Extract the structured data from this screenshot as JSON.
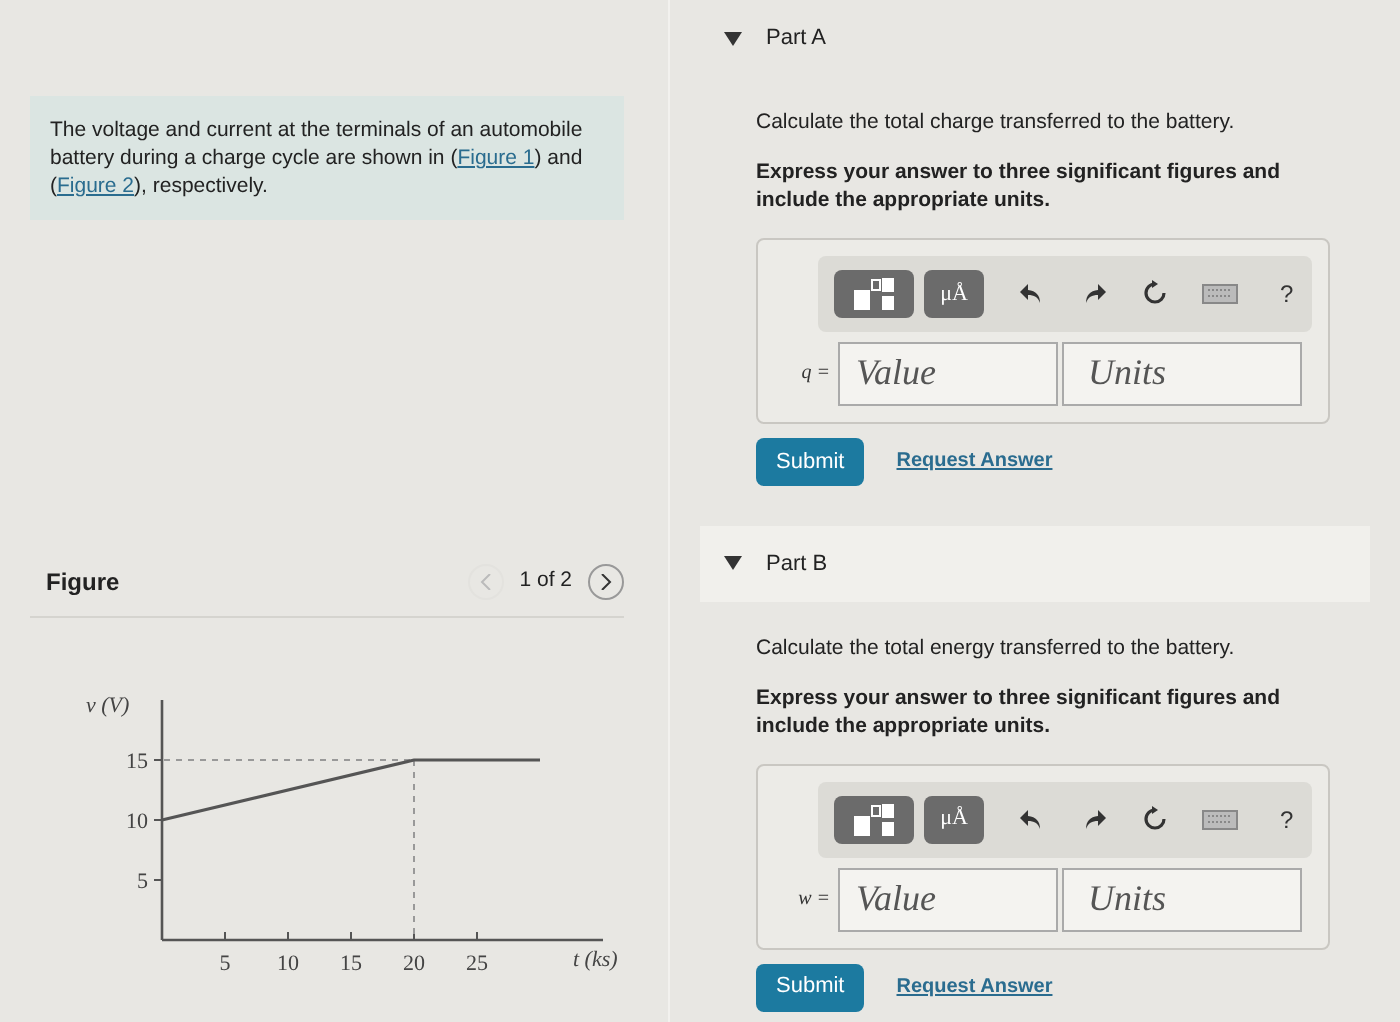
{
  "intro": {
    "parts": [
      {
        "kind": "text",
        "text": "The voltage and current at the terminals of an automobile battery during a charge cycle are shown in ("
      },
      {
        "kind": "link",
        "text": "Figure 1"
      },
      {
        "kind": "text",
        "text": ") and ("
      },
      {
        "kind": "link",
        "text": "Figure 2"
      },
      {
        "kind": "text",
        "text": "), respectively."
      }
    ]
  },
  "figure": {
    "title": "Figure",
    "pager": "1 of 2",
    "prev_disabled": true,
    "next_disabled": false,
    "chart_data": {
      "type": "line",
      "xlabel": "t (ks)",
      "ylabel": "v (V)",
      "x": [
        0,
        20,
        30
      ],
      "series": [
        {
          "color": "#555555",
          "values": [
            10,
            15,
            15
          ]
        }
      ],
      "xlim": [
        0,
        35
      ],
      "ylim": [
        0,
        20
      ],
      "xticks": [
        5,
        10,
        15,
        20,
        25
      ],
      "yticks": [
        5,
        10,
        15
      ],
      "ref_lines": [
        {
          "axis": "y",
          "value": 15
        },
        {
          "axis": "x",
          "value": 20
        }
      ]
    }
  },
  "parts": [
    {
      "label": "Part A",
      "expanded": true,
      "question": "Calculate the total charge transferred to the battery.",
      "instruction": "Express your answer to three significant figures and include the appropriate units.",
      "units_button": "μÅ",
      "help": "?",
      "variable": "q =",
      "value_placeholder": "Value",
      "units_placeholder": "Units",
      "submit": "Submit",
      "request": "Request Answer"
    },
    {
      "label": "Part B",
      "expanded": true,
      "question": "Calculate the total energy transferred to the battery.",
      "instruction": "Express your answer to three significant figures and include the appropriate units.",
      "units_button": "μÅ",
      "help": "?",
      "variable": "w =",
      "value_placeholder": "Value",
      "units_placeholder": "Units",
      "submit": "Submit",
      "request": "Request Answer"
    }
  ]
}
